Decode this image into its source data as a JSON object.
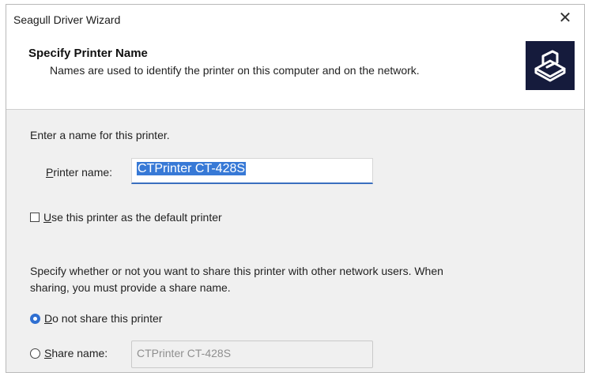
{
  "window": {
    "title": "Seagull Driver Wizard",
    "close_glyph": "✕"
  },
  "header": {
    "title": "Specify Printer Name",
    "subtitle": "Names are used to identify the printer on this computer and on the network.",
    "icon": "printer-icon"
  },
  "form": {
    "intro": "Enter a name for this printer.",
    "printer_name_label_accel": "P",
    "printer_name_label_rest": "rinter name:",
    "printer_name_value": "CTPrinter CT-428S",
    "default_checkbox_accel": "U",
    "default_checkbox_rest": "se this printer as the default printer",
    "default_checked": false,
    "share_desc_line1": "Specify whether or not you want to share this printer with other network users.  When",
    "share_desc_line2": "sharing, you must provide a share name.",
    "no_share_accel": "D",
    "no_share_rest": "o not share this printer",
    "share_name_accel": "S",
    "share_name_rest": "hare name:",
    "share_name_value": "CTPrinter CT-428S",
    "selected_option": "do-not-share"
  },
  "colors": {
    "accent": "#2f6fd1",
    "selection": "#3779d6",
    "icon_bg": "#151b3c"
  }
}
